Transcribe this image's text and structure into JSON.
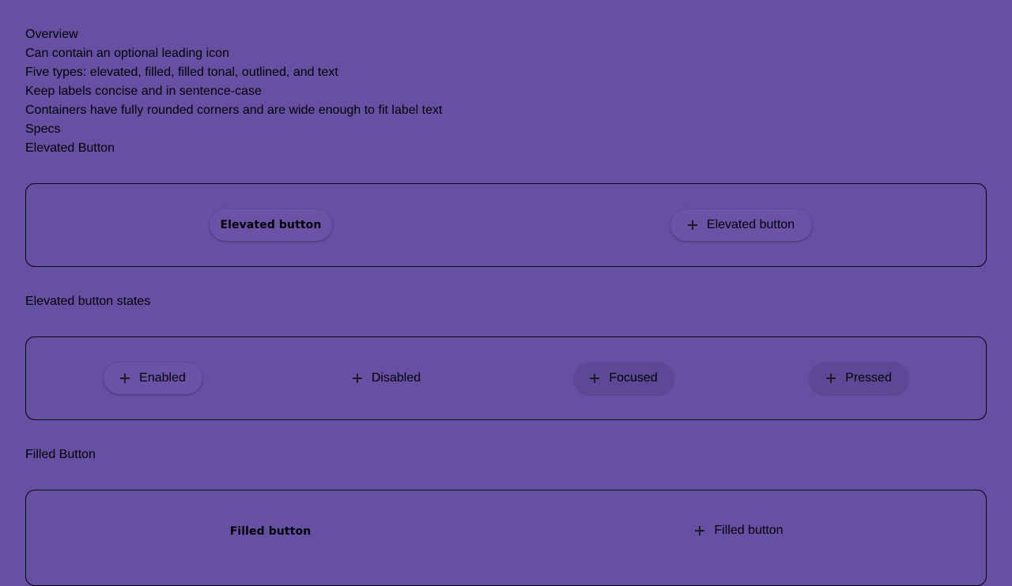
{
  "intro": {
    "lines": [
      "Overview",
      "Can contain an optional leading icon",
      "Five types: elevated, filled, filled tonal, outlined, and text",
      "Keep labels concise and in sentence-case",
      "Containers have fully rounded corners and are wide enough to fit label text",
      "Specs",
      "Elevated Button"
    ]
  },
  "elevated_demo": {
    "plain_label": "Elevated button",
    "icon_label": "Elevated button",
    "icon": "plus-icon"
  },
  "states_section": {
    "heading": "Elevated button states",
    "states": [
      {
        "label": "Enabled",
        "icon": "plus-icon"
      },
      {
        "label": "Disabled",
        "icon": "plus-icon"
      },
      {
        "label": "Focused",
        "icon": "plus-icon"
      },
      {
        "label": "Pressed",
        "icon": "plus-icon"
      }
    ]
  },
  "filled_section": {
    "heading": "Filled Button",
    "plain_label": "Filled button",
    "icon_label": "Filled button",
    "icon": "plus-icon"
  },
  "colors": {
    "background": "#6750a4",
    "surface_focused": "#5d4896",
    "border": "#000000"
  }
}
